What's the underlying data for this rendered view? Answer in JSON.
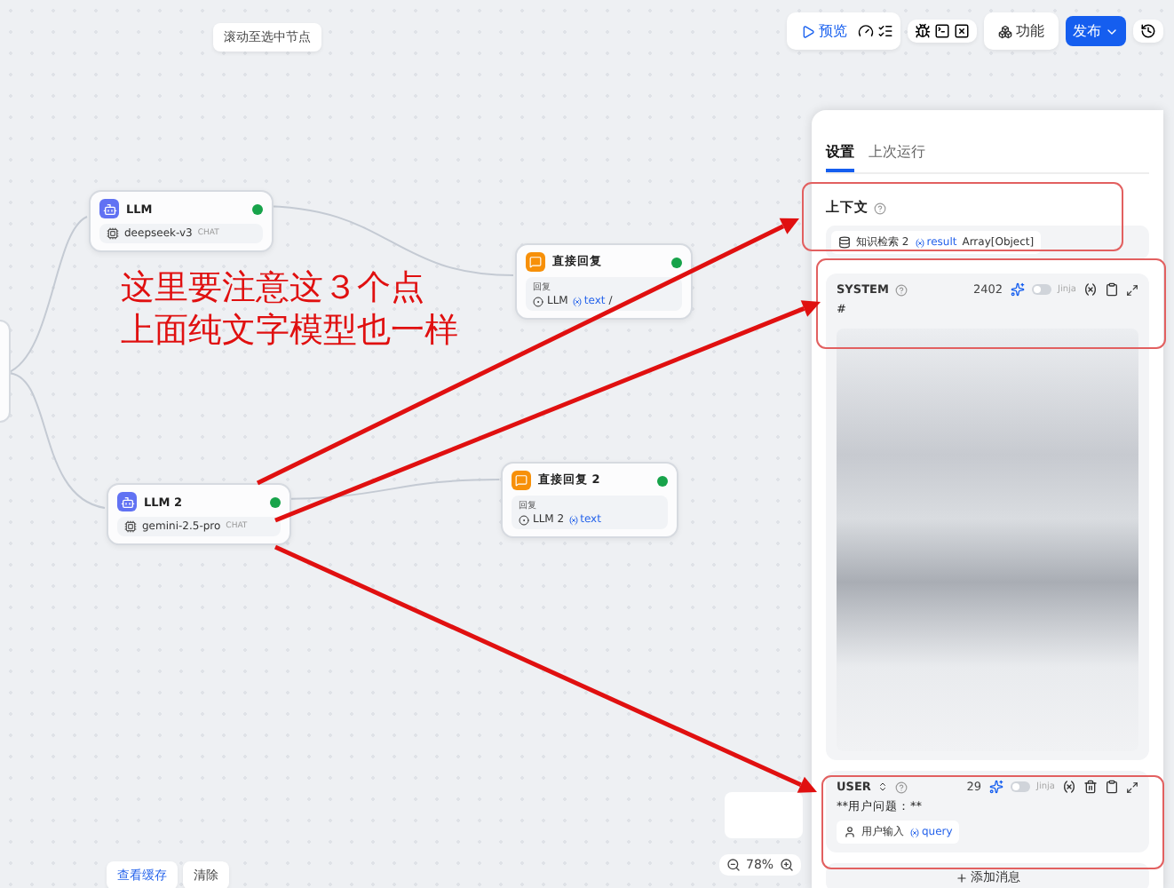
{
  "toolbar": {
    "hint": "滚动至选中节点",
    "preview": "预览",
    "features": "功能",
    "publish": "发布"
  },
  "canvas": {
    "nodes": [
      {
        "kind": "llm",
        "title": "LLM",
        "model": "deepseek-v3",
        "badge": "CHAT"
      },
      {
        "kind": "answer",
        "title": "直接回复",
        "field_label": "回复",
        "ref_node": "LLM",
        "ref_var": "text",
        "suffix": "/"
      },
      {
        "kind": "llm",
        "title": "LLM 2",
        "model": "gemini-2.5-pro",
        "badge": "CHAT"
      },
      {
        "kind": "answer",
        "title": "直接回复 2",
        "field_label": "回复",
        "ref_node": "LLM 2",
        "ref_var": "text"
      }
    ],
    "annotation": [
      "这里要注意这３个点",
      "上面纯文字模型也一样"
    ],
    "cache_buttons": [
      "查看缓存",
      "清除"
    ],
    "zoom": "78%"
  },
  "panel": {
    "tabs": [
      {
        "label": "设置",
        "selected": true
      },
      {
        "label": "上次运行",
        "selected": false
      }
    ],
    "context": {
      "label": "上下文",
      "source": "知识检索 2",
      "var": "result",
      "type": "Array[Object]"
    },
    "messages": [
      {
        "kind": "system",
        "role": "SYSTEM",
        "tokens": "2402",
        "jinja": false,
        "jinja_label": "Jinja",
        "lines": [
          "#"
        ]
      },
      {
        "kind": "user",
        "role": "USER",
        "tokens": "29",
        "jinja": false,
        "jinja_label": "Jinja",
        "lines": [
          "**用户问题：**"
        ],
        "input": "用户输入",
        "var": "query"
      }
    ],
    "add": "添加消息"
  }
}
